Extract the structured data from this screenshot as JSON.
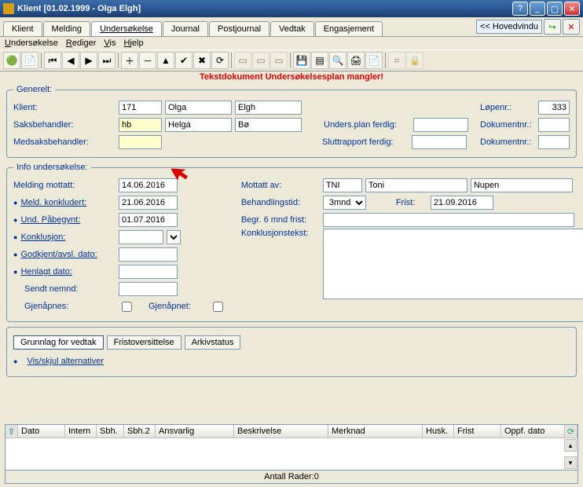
{
  "window": {
    "title": "Klient [01.02.1999 - Olga Elgh]"
  },
  "tabs": {
    "klient": "Klient",
    "melding": "Melding",
    "undersokelse": "Undersøkelse",
    "journal": "Journal",
    "postjournal": "Postjournal",
    "vedtak": "Vedtak",
    "engasjement": "Engasjement",
    "hovedvindu": "<< Hovedvindu"
  },
  "menu": {
    "undersokelse": "Undersøkelse",
    "rediger": "Rediger",
    "vis": "Vis",
    "hjelp": "Hjelp"
  },
  "warning": "Tekstdokument Undersøkelsesplan mangler!",
  "generelt": {
    "legend": "Generelt:",
    "klient_lbl": "Klient:",
    "klient_id": "171",
    "fornavn": "Olga",
    "etternavn": "Elgh",
    "saks_lbl": "Saksbehandler:",
    "saks_code": "hb",
    "saks_fn": "Helga",
    "saks_ln": "Bø",
    "medsaks_lbl": "Medsaksbehandler:",
    "medsaks_val": "",
    "undersplan_lbl": "Unders.plan ferdig:",
    "undersplan_val": "",
    "slutt_lbl": "Sluttrapport ferdig:",
    "slutt_val": "",
    "lopenr_lbl": "Løpenr.:",
    "lopenr_val": "333",
    "dok1_lbl": "Dokumentnr.:",
    "dok1_val": "",
    "dok2_lbl": "Dokumentnr.:",
    "dok2_val": ""
  },
  "info": {
    "legend": "Info undersøkelse:",
    "mottatt_lbl": "Melding mottatt:",
    "mottatt_val": "14.06.2016",
    "konkludert_lbl": "Meld. konkludert:",
    "konkludert_val": "21.06.2016",
    "pabegynt_lbl": "Und. Påbegynt:",
    "pabegynt_val": "01.07.2016",
    "konklusjon_lbl": "Konklusjon:",
    "konklusjon_val": "",
    "godkjent_lbl": "Godkjent/avsl. dato:",
    "godkjent_val": "",
    "henlagt_lbl": "Henlagt dato:",
    "henlagt_val": "",
    "sendt_lbl": "Sendt nemnd:",
    "sendt_val": "",
    "gjenapnes_lbl": "Gjenåpnes:",
    "gjenapnet_lbl": "Gjenåpnet:",
    "mottattav_lbl": "Mottatt av:",
    "mottattav_code": "TNI",
    "mottattav_fn": "Toni",
    "mottattav_ln": "Nupen",
    "behandling_lbl": "Behandlingstid:",
    "behandling_val": "3mnd",
    "frist_lbl": "Frist:",
    "frist_val": "21.09.2016",
    "begr_lbl": "Begr. 6 mnd frist:",
    "begr_val": "",
    "konk_tekst_lbl": "Konklusjonstekst:",
    "konk_tekst_val": ""
  },
  "lowtabs": {
    "grunnlag": "Grunnlag for vedtak",
    "fristover": "Fristoversittelse",
    "arkiv": "Arkivstatus"
  },
  "vislink": "Vis/skjul alternativer",
  "grid": {
    "cols": [
      "Dato",
      "Intern",
      "Sbh.",
      "Sbh.2",
      "Ansvarlig",
      "Beskrivelse",
      "Merknad",
      "Husk.",
      "Frist",
      "Oppf. dato"
    ]
  },
  "status": {
    "label": "Antall Rader:",
    "count": "0"
  }
}
